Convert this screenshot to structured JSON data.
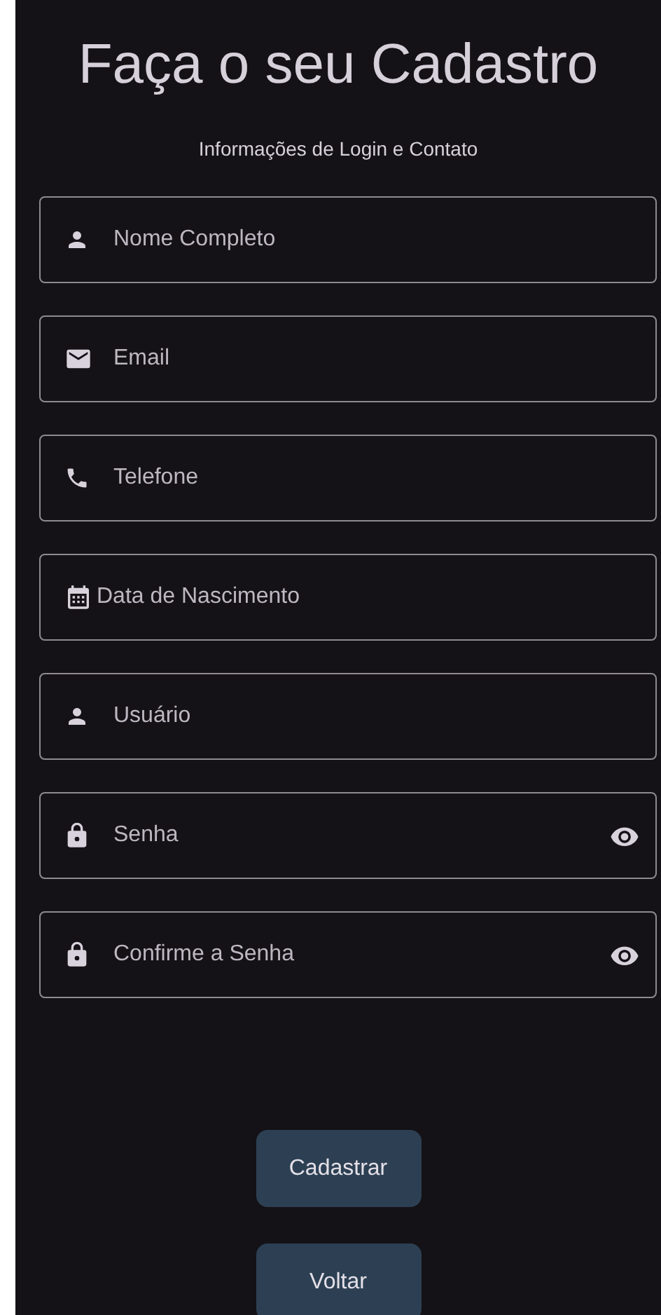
{
  "title": "Faça o seu Cadastro",
  "subtitle": "Informações de Login e Contato",
  "fields": [
    {
      "kind": "person",
      "placeholder": "Nome Completo",
      "password": false
    },
    {
      "kind": "mail",
      "placeholder": "Email",
      "password": false
    },
    {
      "kind": "phone",
      "placeholder": "Telefone",
      "password": false
    },
    {
      "kind": "calendar",
      "placeholder": "Data de Nascimento",
      "password": false
    },
    {
      "kind": "person",
      "placeholder": "Usuário",
      "password": false
    },
    {
      "kind": "lock",
      "placeholder": "Senha",
      "password": true
    },
    {
      "kind": "lock",
      "placeholder": "Confirme a Senha",
      "password": true
    }
  ],
  "buttons": [
    "Cadastrar",
    "Voltar"
  ]
}
